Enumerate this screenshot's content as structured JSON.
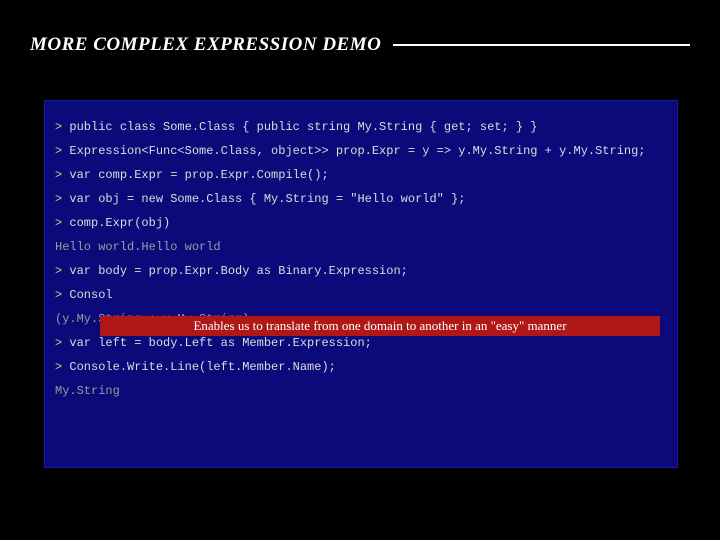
{
  "title": "MORE COMPLEX EXPRESSION DEMO",
  "prompt": ">",
  "lines": [
    {
      "kind": "cmd",
      "text": "public class Some.Class { public string My.String { get; set; } }"
    },
    {
      "kind": "cmd",
      "text": "Expression<Func<Some.Class, object>> prop.Expr = y => y.My.String + y.My.String;"
    },
    {
      "kind": "cmd",
      "text": "var comp.Expr = prop.Expr.Compile();"
    },
    {
      "kind": "cmd",
      "text": "var obj = new Some.Class { My.String = \"Hello world\" };"
    },
    {
      "kind": "cmd",
      "text": "comp.Expr(obj)"
    },
    {
      "kind": "output",
      "text": "Hello world.Hello world"
    },
    {
      "kind": "cmd",
      "text": "var body = prop.Expr.Body as Binary.Expression;"
    },
    {
      "kind": "cmd",
      "text": "Consol"
    },
    {
      "kind": "output",
      "text": "(y.My.String + y.My.String)"
    },
    {
      "kind": "cmd",
      "text": "var left = body.Left as Member.Expression;"
    },
    {
      "kind": "cmd",
      "text": "Console.Write.Line(left.Member.Name);"
    },
    {
      "kind": "output",
      "text": "My.String"
    }
  ],
  "callout": "Enables us to translate from one domain to another in an \"easy\" manner",
  "colors": {
    "background": "#000000",
    "console_bg": "#0a0a7a",
    "console_border": "#1a1aaa",
    "prompt": "#cfcf7a",
    "code": "#dcdcdc",
    "output": "#9a9a9a",
    "callout_bg": "#b01818",
    "callout_fg": "#ffffff"
  }
}
